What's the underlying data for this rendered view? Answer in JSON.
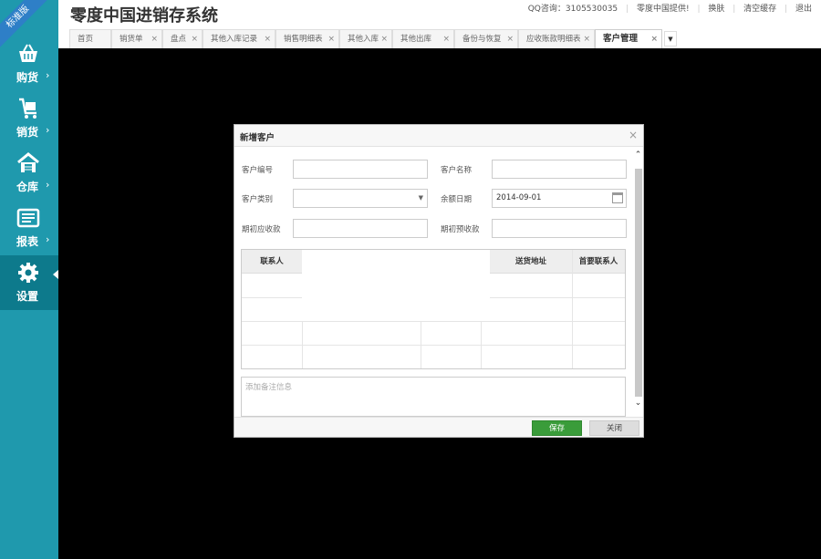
{
  "app": {
    "title": "零度中国进销存系统",
    "edition_badge": "标准版"
  },
  "top_links": {
    "qq": "QQ咨询：3105530035",
    "provider": "零度中国提供!",
    "skin": "换肤",
    "clear_cache": "清空缓存",
    "logout": "退出"
  },
  "sidebar": {
    "items": [
      {
        "label": "购货",
        "icon": "basket-icon",
        "arrow": "›"
      },
      {
        "label": "销货",
        "icon": "cart-icon",
        "arrow": "›"
      },
      {
        "label": "仓库",
        "icon": "warehouse-icon",
        "arrow": "›"
      },
      {
        "label": "报表",
        "icon": "report-icon",
        "arrow": "›"
      },
      {
        "label": "设置",
        "icon": "gear-icon",
        "arrow": ""
      }
    ],
    "active_index": 4
  },
  "tabs": [
    {
      "label": "首页",
      "closable": false
    },
    {
      "label": "销货单",
      "closable": true
    },
    {
      "label": "盘点",
      "closable": true
    },
    {
      "label": "其他入库记录",
      "closable": true
    },
    {
      "label": "销售明细表",
      "closable": true
    },
    {
      "label": "其他入库",
      "closable": true
    },
    {
      "label": "其他出库",
      "closable": true
    },
    {
      "label": "备份与恢复",
      "closable": true
    },
    {
      "label": "应收账款明细表",
      "closable": true
    },
    {
      "label": "客户管理",
      "closable": true,
      "active": true
    }
  ],
  "tab_close_glyph": "×",
  "tab_more_glyph": "▼",
  "dialog": {
    "title": "新增客户",
    "close_glyph": "×",
    "fields": {
      "customer_code_label": "客户编号",
      "customer_code_value": "",
      "customer_name_label": "客户名称",
      "customer_name_value": "",
      "customer_type_label": "客户类别",
      "customer_type_value": "",
      "balance_date_label": "余额日期",
      "balance_date_value": "2014-09-01",
      "initial_receivable_label": "期初应收款",
      "initial_receivable_value": "",
      "initial_prepaid_label": "期初预收款",
      "initial_prepaid_value": ""
    },
    "contacts_table": {
      "headers": {
        "contact": "联系人",
        "address": "送货地址",
        "primary": "首要联系人"
      }
    },
    "remark_placeholder": "添加备注信息",
    "buttons": {
      "save": "保存",
      "close": "关闭"
    },
    "scroll_up_glyph": "⌃",
    "scroll_down_glyph": "⌄"
  },
  "colors": {
    "sidebar": "#1f99ad",
    "sidebar_active": "#0d7a8c",
    "save_button": "#3a9c3a",
    "backdrop": "#000000"
  }
}
